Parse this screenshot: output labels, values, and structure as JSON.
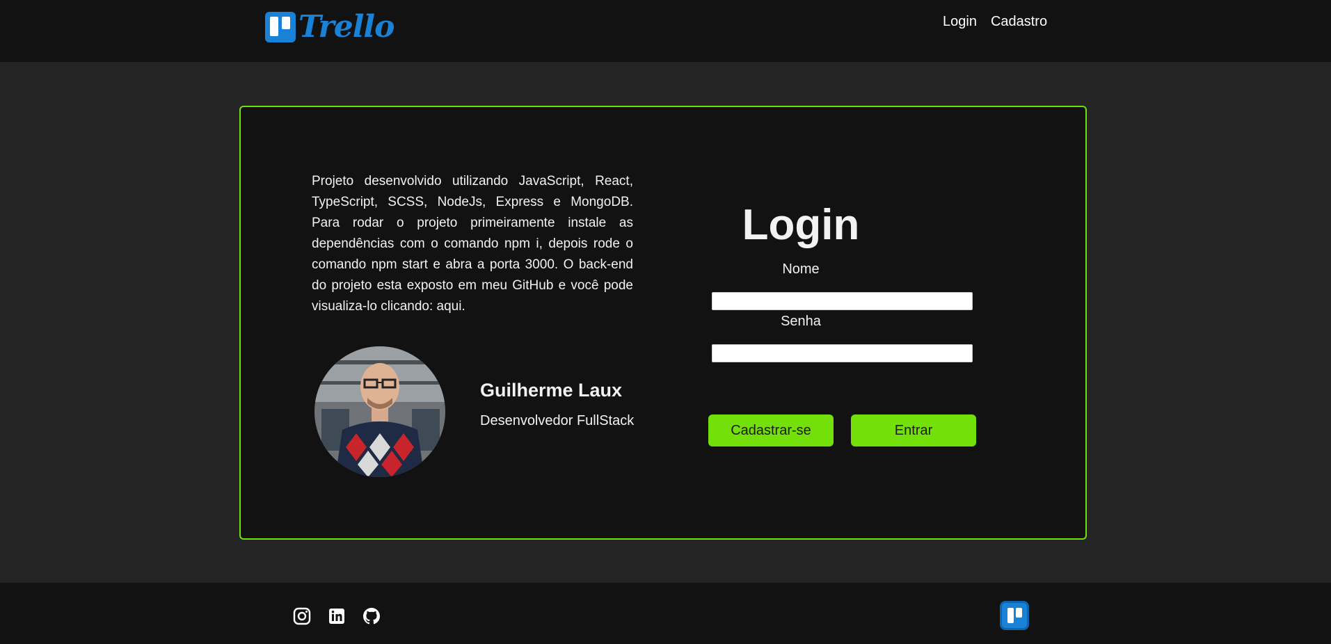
{
  "header": {
    "logo_text": "Trello",
    "nav": {
      "login": "Login",
      "signup": "Cadastro"
    }
  },
  "about": {
    "description": "Projeto desenvolvido utilizando JavaScript, React, TypeScript, SCSS, NodeJs, Express e MongoDB. Para rodar o projeto primeiramente instale as dependências com o comando npm i, depois rode o comando npm start e abra a porta 3000. O back-end do projeto esta exposto em meu GitHub e você pode visualiza-lo clicando:  aqui.",
    "developer_name": "Guilherme Laux",
    "developer_role": "Desenvolvedor FullStack"
  },
  "login_form": {
    "title": "Login",
    "name_label": "Nome",
    "name_value": "",
    "password_label": "Senha",
    "password_value": "",
    "signup_button": "Cadastrar-se",
    "enter_button": "Entrar"
  },
  "footer": {
    "icons": [
      "instagram-icon",
      "linkedin-icon",
      "github-icon",
      "trello-icon"
    ]
  },
  "colors": {
    "accent": "#74e00a",
    "trello_blue": "#1a82d6",
    "header_bg": "#121212",
    "page_bg": "#242424"
  }
}
